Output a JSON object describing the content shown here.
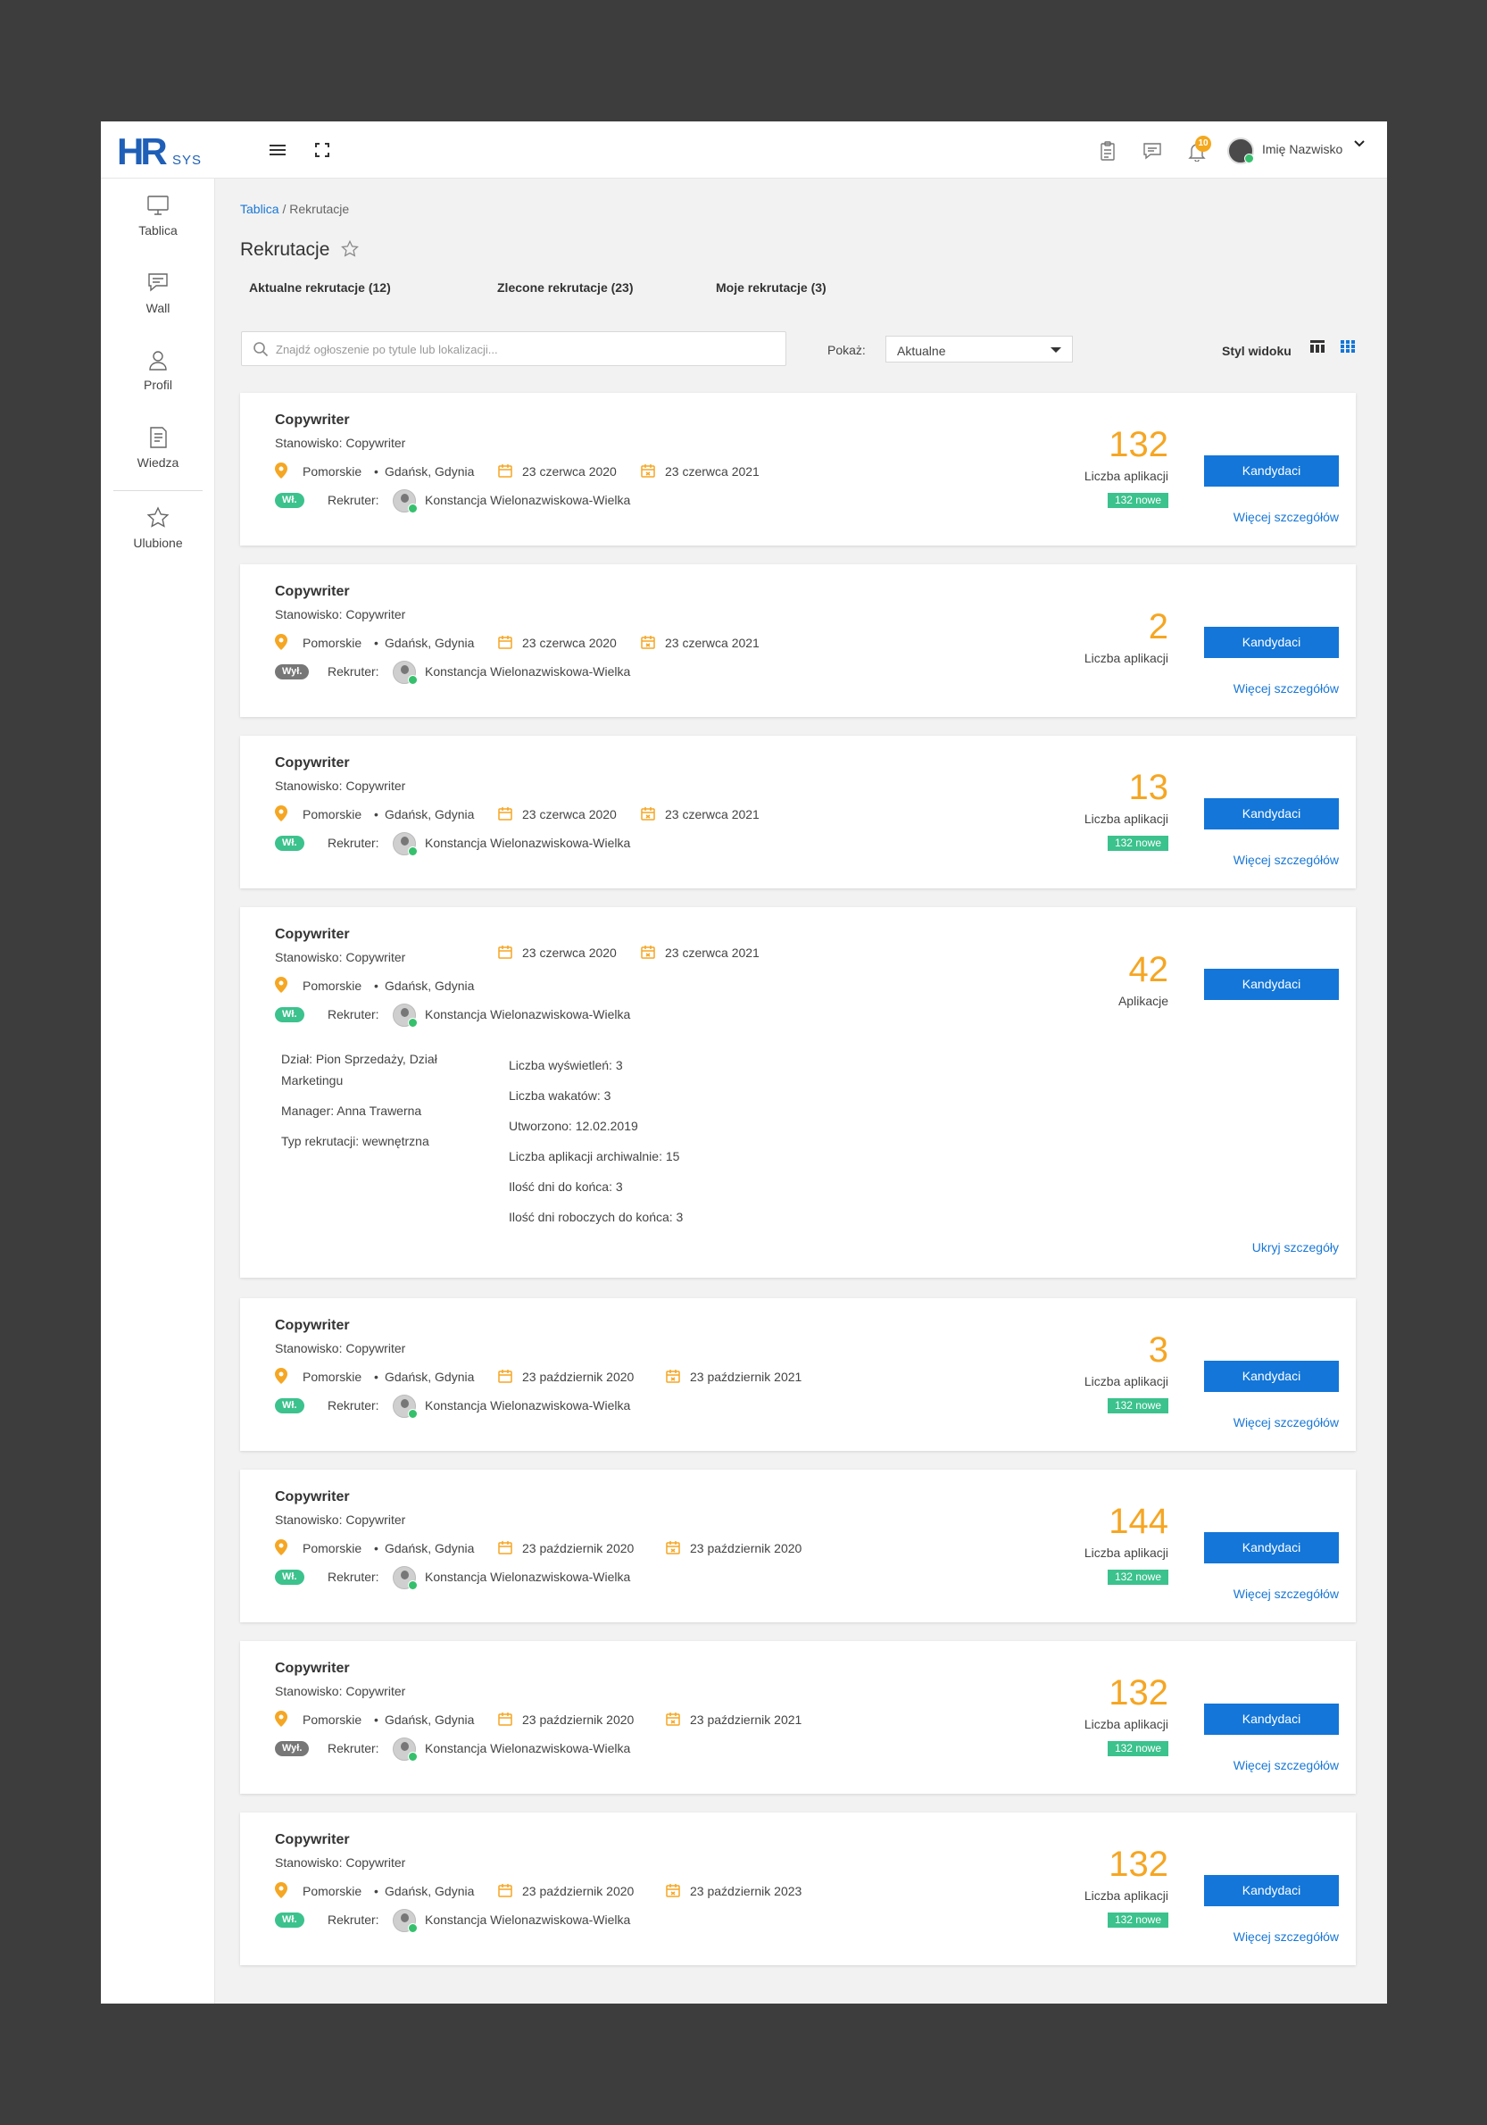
{
  "header": {
    "logo_main": "HR",
    "logo_sub": "SYS",
    "notifications_count": "10",
    "user_name": "Imię Nazwisko"
  },
  "sidebar": {
    "items": [
      {
        "label": "Tablica",
        "icon": "monitor-icon"
      },
      {
        "label": "Wall",
        "icon": "chat-icon"
      },
      {
        "label": "Profil",
        "icon": "user-icon"
      },
      {
        "label": "Wiedza",
        "icon": "document-icon"
      },
      {
        "label": "Ulubione",
        "icon": "star-icon"
      }
    ]
  },
  "breadcrumb": {
    "link": "Tablica",
    "separator": "/",
    "current": "Rekrutacje"
  },
  "page": {
    "title": "Rekrutacje"
  },
  "tabs": [
    {
      "label": "Aktualne rekrutacje (12)",
      "active": false
    },
    {
      "label": "Zlecone rekrutacje (23)",
      "active": true
    },
    {
      "label": "Moje rekrutacje (3)",
      "active": false
    }
  ],
  "search": {
    "placeholder": "Znajdź ogłoszenie po tytule lub lokalizacji..."
  },
  "filter": {
    "label": "Pokaż:",
    "value": "Aktualne"
  },
  "view": {
    "label": "Styl widoku"
  },
  "colors": {
    "accent": "#1376d8",
    "count": "#f5a623",
    "status_on": "#3cc28d",
    "status_off": "#777777"
  },
  "labels": {
    "recruiter": "Rekruter:",
    "candidates_button": "Kandydaci",
    "more_details": "Więcej szczegółów",
    "hide_details": "Ukryj szczegóły"
  },
  "cards": [
    {
      "title": "Copywriter",
      "position": "Stanowisko: Copywriter",
      "region": "Pomorskie",
      "city": "Gdańsk, Gdynia",
      "date_from": "23 czerwca 2020",
      "date_to": "23 czerwca 2021",
      "status": "Wł.",
      "recruiter": "Konstancja Wielonazwiskowa-Wielka",
      "count": "132",
      "count_label": "Liczba aplikacji",
      "new": "132 nowe"
    },
    {
      "title": "Copywriter",
      "position": "Stanowisko: Copywriter",
      "region": "Pomorskie",
      "city": "Gdańsk, Gdynia",
      "date_from": "23 czerwca 2020",
      "date_to": "23 czerwca 2021",
      "status": "Wył.",
      "recruiter": "Konstancja Wielonazwiskowa-Wielka",
      "count": "2",
      "count_label": "Liczba aplikacji",
      "new": ""
    },
    {
      "title": "Copywriter",
      "position": "Stanowisko: Copywriter",
      "region": "Pomorskie",
      "city": "Gdańsk, Gdynia",
      "date_from": "23 czerwca 2020",
      "date_to": "23 czerwca 2021",
      "status": "Wł.",
      "recruiter": "Konstancja Wielonazwiskowa-Wielka",
      "count": "13",
      "count_label": "Liczba aplikacji",
      "new": "132 nowe"
    },
    {
      "title": "Copywriter",
      "position": "Stanowisko: Copywriter",
      "region": "Pomorskie",
      "city": "Gdańsk, Gdynia",
      "date_from": "23 czerwca 2020",
      "date_to": "23 czerwca 2021",
      "status": "Wł.",
      "recruiter": "Konstancja Wielonazwiskowa-Wielka",
      "count": "42",
      "count_label": "Aplikacje",
      "new": "",
      "details_left": [
        "Dział: Pion Sprzedaży, Dział",
        "Marketingu",
        "Manager: Anna Trawerna",
        "Typ rekrutacji: wewnętrzna"
      ],
      "details_right": [
        "Liczba wyświetleń: 3",
        "Liczba wakatów: 3",
        "Utworzono: 12.02.2019",
        "Liczba aplikacji archiwalnie: 15",
        "Ilość dni do końca: 3",
        "Ilość dni roboczych do końca: 3"
      ]
    },
    {
      "title": "Copywriter",
      "position": "Stanowisko: Copywriter",
      "region": "Pomorskie",
      "city": "Gdańsk, Gdynia",
      "date_from": "23 październik 2020",
      "date_to": "23 październik 2021",
      "status": "Wł.",
      "recruiter": "Konstancja Wielonazwiskowa-Wielka",
      "count": "3",
      "count_label": "Liczba aplikacji",
      "new": "132 nowe"
    },
    {
      "title": "Copywriter",
      "position": "Stanowisko: Copywriter",
      "region": "Pomorskie",
      "city": "Gdańsk, Gdynia",
      "date_from": "23 październik 2020",
      "date_to": "23 październik 2020",
      "status": "Wł.",
      "recruiter": "Konstancja Wielonazwiskowa-Wielka",
      "count": "144",
      "count_label": "Liczba aplikacji",
      "new": "132 nowe"
    },
    {
      "title": "Copywriter",
      "position": "Stanowisko: Copywriter",
      "region": "Pomorskie",
      "city": "Gdańsk, Gdynia",
      "date_from": "23 październik 2020",
      "date_to": "23 październik 2021",
      "status": "Wył.",
      "recruiter": "Konstancja Wielonazwiskowa-Wielka",
      "count": "132",
      "count_label": "Liczba aplikacji",
      "new": "132 nowe"
    },
    {
      "title": "Copywriter",
      "position": "Stanowisko: Copywriter",
      "region": "Pomorskie",
      "city": "Gdańsk, Gdynia",
      "date_from": "23 październik 2020",
      "date_to": "23 październik 2023",
      "status": "Wł.",
      "recruiter": "Konstancja Wielonazwiskowa-Wielka",
      "count": "132",
      "count_label": "Liczba aplikacji",
      "new": "132 nowe"
    }
  ]
}
